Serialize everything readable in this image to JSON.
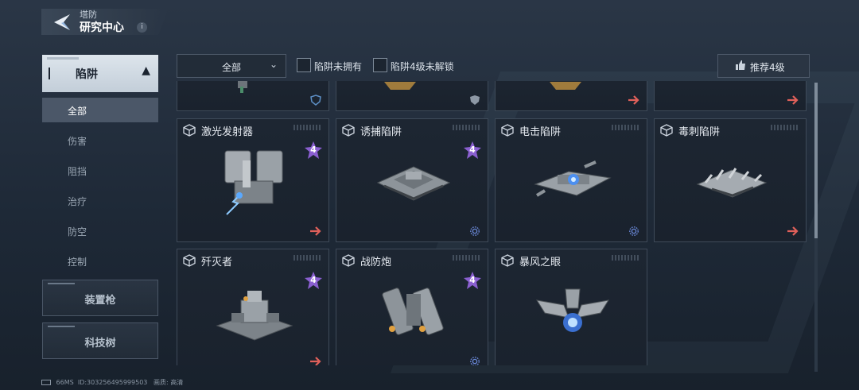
{
  "header": {
    "section": "塔防",
    "title": "研究中心",
    "info_glyph": "i"
  },
  "sidebar": {
    "category": "陷阱",
    "sub_items": [
      {
        "label": "全部",
        "active": true
      },
      {
        "label": "伤害",
        "active": false
      },
      {
        "label": "阻挡",
        "active": false
      },
      {
        "label": "治疗",
        "active": false
      },
      {
        "label": "防空",
        "active": false
      },
      {
        "label": "控制",
        "active": false
      }
    ],
    "buttons": [
      {
        "label": "装置枪"
      },
      {
        "label": "科技树"
      }
    ]
  },
  "filters": {
    "dropdown_value": "全部",
    "checkbox_not_owned": "陷阱未拥有",
    "checkbox_level4_locked": "陷阱4级未解锁",
    "recommend_button": "推荐4级"
  },
  "cards": [
    {
      "name": "",
      "level_badge": "",
      "action_icon": "shield-icon"
    },
    {
      "name": "",
      "level_badge": "",
      "action_icon": "shield-icon"
    },
    {
      "name": "",
      "level_badge": "",
      "action_icon": "arrow-right-icon"
    },
    {
      "name": "",
      "level_badge": "",
      "action_icon": "arrow-right-icon"
    },
    {
      "name": "激光发射器",
      "level_badge": "4",
      "action_icon": "arrow-right-icon"
    },
    {
      "name": "诱捕陷阱",
      "level_badge": "4",
      "action_icon": "gear-icon"
    },
    {
      "name": "电击陷阱",
      "level_badge": "",
      "action_icon": "gear-icon"
    },
    {
      "name": "毒刺陷阱",
      "level_badge": "",
      "action_icon": "arrow-right-icon"
    },
    {
      "name": "歼灭者",
      "level_badge": "4",
      "action_icon": "arrow-right-icon"
    },
    {
      "name": "战防炮",
      "level_badge": "4",
      "action_icon": "gear-icon"
    },
    {
      "name": "暴风之眼",
      "level_badge": "",
      "action_icon": ""
    }
  ],
  "status_bar": {
    "ping": "66MS",
    "player_id": "ID:303256495999503",
    "quality_label": "画质:",
    "quality_value": "高清"
  },
  "colors": {
    "accent_arrow": "#e0605a",
    "badge_purple": "#8a5fd0",
    "panel_border": "#3e4a59"
  }
}
